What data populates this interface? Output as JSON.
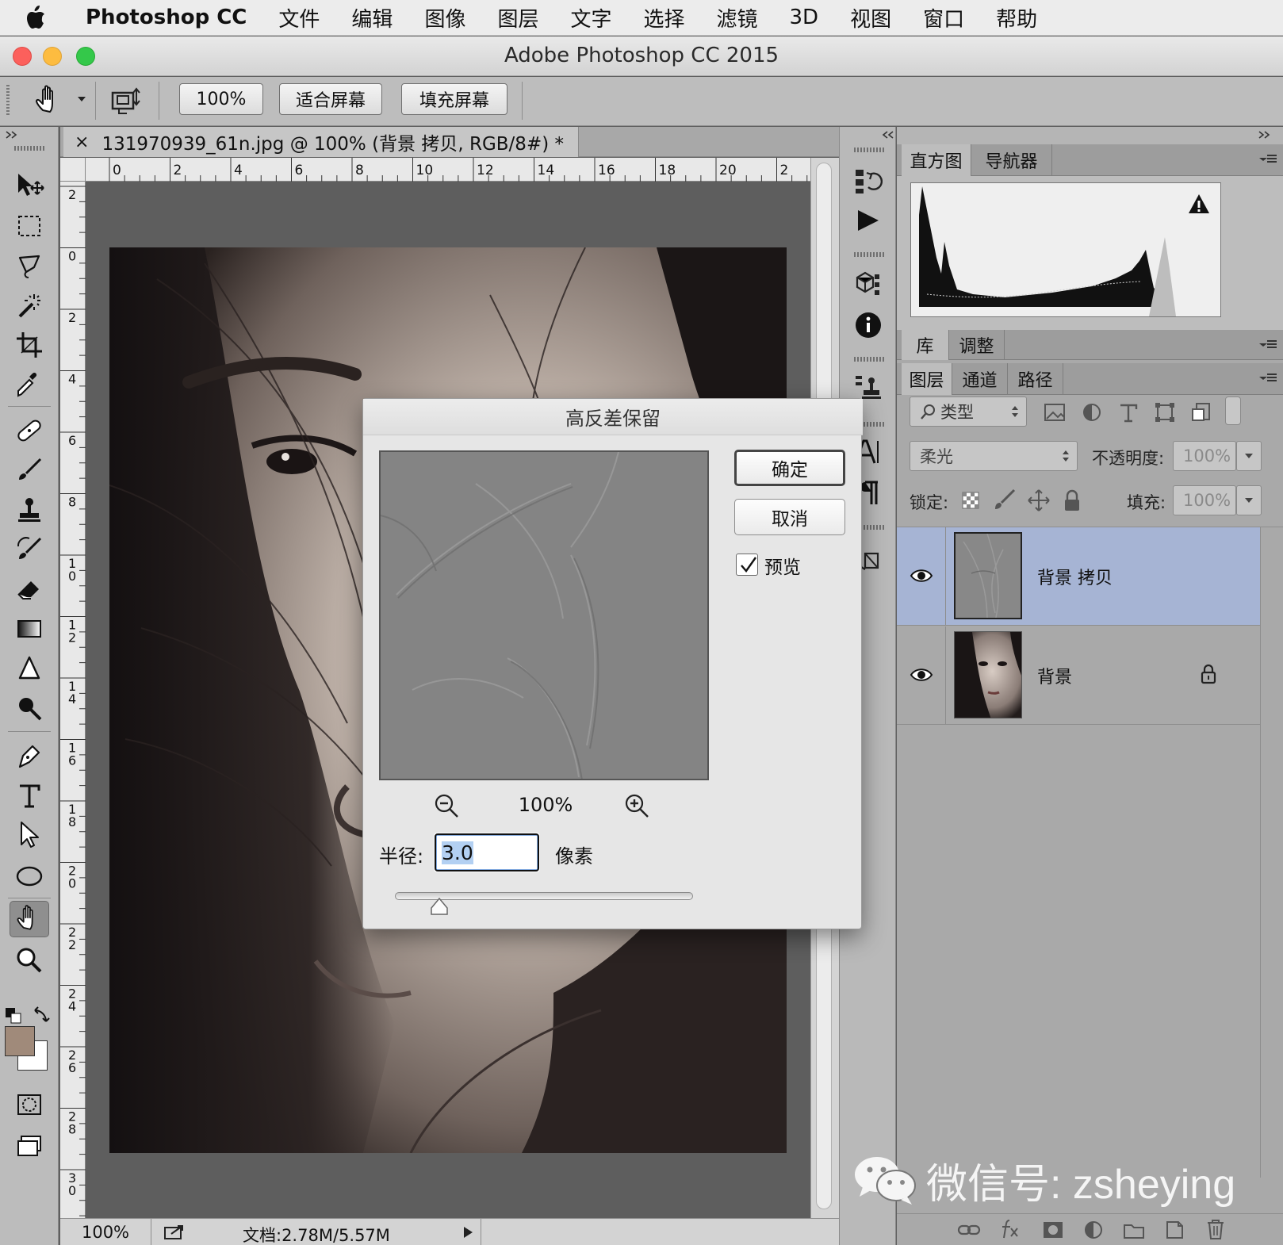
{
  "menubar": {
    "app": "Photoshop CC",
    "items": [
      "文件",
      "编辑",
      "图像",
      "图层",
      "文字",
      "选择",
      "滤镜",
      "3D",
      "视图",
      "窗口",
      "帮助"
    ]
  },
  "window": {
    "title": "Adobe Photoshop CC 2015"
  },
  "options": {
    "zoom_btn": "100%",
    "fit_screen_btn": "适合屏幕",
    "fill_screen_btn": "填充屏幕"
  },
  "document": {
    "tab_title": "131970939_61n.jpg @ 100% (背景 拷贝, RGB/8#) *",
    "close_symbol": "×",
    "ruler_top_labels": [
      "0",
      "2",
      "4",
      "6",
      "8",
      "10",
      "12",
      "14",
      "16",
      "18",
      "20",
      "2"
    ],
    "ruler_left_labels": [
      "2",
      "0",
      "2",
      "4",
      "6",
      "8",
      "1 0",
      "1 2",
      "1 4",
      "1 6",
      "1 8",
      "2 0",
      "2 2",
      "2 4",
      "2 6",
      "2 8",
      "3 0"
    ],
    "status_zoom": "100%",
    "status_doc": "文档:2.78M/5.57M"
  },
  "panels": {
    "histogram_tab": "直方图",
    "navigator_tab": "导航器",
    "library_tab": "库",
    "adjust_tab": "调整",
    "layers_tab": "图层",
    "channels_tab": "通道",
    "paths_tab": "路径",
    "filter_kind": "类型",
    "blend_mode": "柔光",
    "opacity_label": "不透明度:",
    "opacity_value": "100%",
    "lock_label": "锁定:",
    "fill_label": "填充:",
    "fill_value": "100%",
    "layers": [
      {
        "name": "背景 拷贝",
        "selected": true,
        "locked": false
      },
      {
        "name": "背景",
        "selected": false,
        "locked": true
      }
    ]
  },
  "dialog": {
    "title": "高反差保留",
    "ok": "确定",
    "cancel": "取消",
    "preview_label": "预览",
    "preview_checked": true,
    "zoom": "100%",
    "radius_label": "半径:",
    "radius_value": "3.0",
    "unit": "像素"
  },
  "watermark": {
    "text": "微信号: zsheying"
  },
  "colors": {
    "foreground": "#a08a7a",
    "background": "#ffffff",
    "selected_layer": "#a6b4d4"
  }
}
